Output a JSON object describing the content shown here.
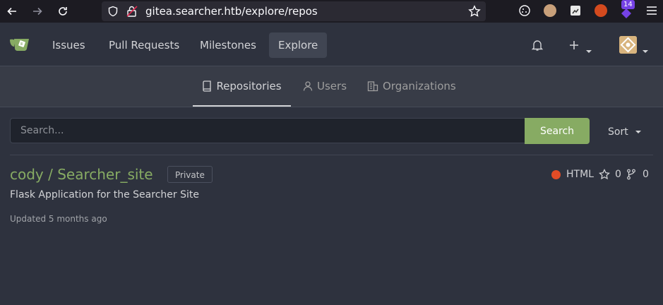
{
  "browser": {
    "url": "gitea.searcher.htb/explore/repos",
    "extension_badge": "14"
  },
  "header": {
    "nav": [
      {
        "label": "Issues"
      },
      {
        "label": "Pull Requests"
      },
      {
        "label": "Milestones"
      },
      {
        "label": "Explore"
      }
    ]
  },
  "subnav": {
    "tabs": [
      {
        "label": "Repositories"
      },
      {
        "label": "Users"
      },
      {
        "label": "Organizations"
      }
    ]
  },
  "search": {
    "placeholder": "Search...",
    "button_label": "Search",
    "sort_label": "Sort"
  },
  "repo": {
    "title": "cody / Searcher_site",
    "badge": "Private",
    "description": "Flask Application for the Searcher Site",
    "updated": "Updated 5 months ago",
    "language": "HTML",
    "language_color": "#e34c26",
    "stars": "0",
    "forks": "0"
  },
  "colors": {
    "accent": "#87ab63",
    "background": "#2e323e"
  }
}
